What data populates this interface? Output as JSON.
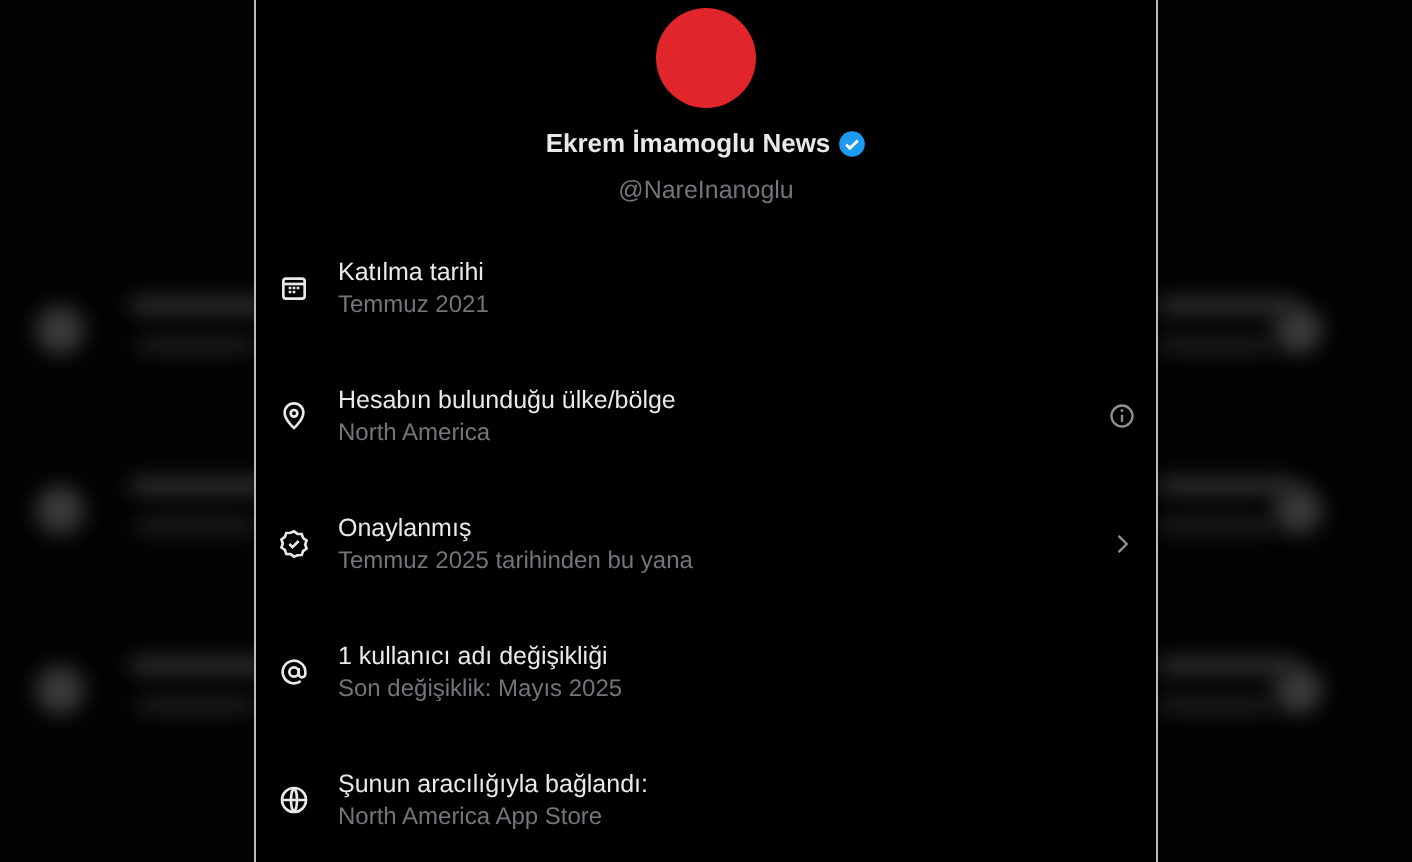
{
  "profile": {
    "display_name": "Ekrem İmamoglu News",
    "verified": true,
    "handle": "@NareInanoglu"
  },
  "rows": [
    {
      "kind": "plain",
      "title": "Katılma tarihi",
      "subtitle": "Temmuz 2021"
    },
    {
      "kind": "info",
      "title": "Hesabın bulunduğu ülke/bölge",
      "subtitle": "North America"
    },
    {
      "kind": "link",
      "title": "Onaylanmış",
      "subtitle": "Temmuz 2025 tarihinden bu yana"
    },
    {
      "kind": "plain",
      "title": "1 kullanıcı adı değişikliği",
      "subtitle": "Son değişiklik: Mayıs 2025"
    },
    {
      "kind": "plain",
      "title": "Şunun aracılığıyla bağlandı:",
      "subtitle": "North America App Store"
    }
  ]
}
